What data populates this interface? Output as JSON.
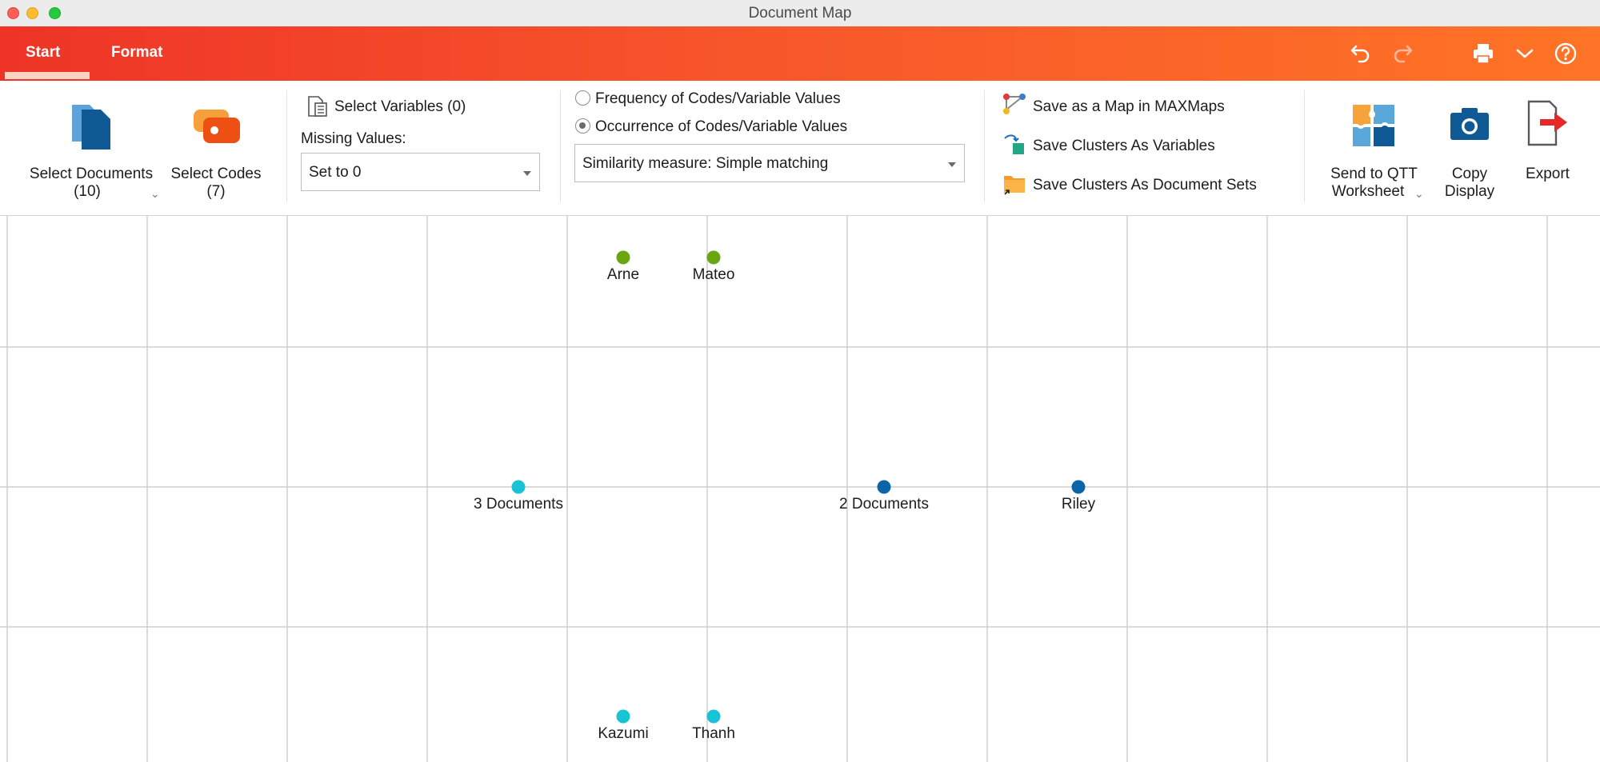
{
  "window": {
    "title": "Document Map"
  },
  "ribbon": {
    "tabs": [
      {
        "label": "Start",
        "active": true
      },
      {
        "label": "Format",
        "active": false
      }
    ],
    "right_icons": [
      "undo-icon",
      "redo-icon",
      "print-icon",
      "chevron-down-icon",
      "help-icon"
    ]
  },
  "toolbar": {
    "select_documents": {
      "line1": "Select Documents",
      "line2": "(10)"
    },
    "select_codes": {
      "line1": "Select Codes",
      "line2": "(7)"
    },
    "select_variables": "Select Variables (0)",
    "missing_values_label": "Missing Values:",
    "missing_values_value": "Set to 0",
    "radio_frequency": "Frequency of Codes/Variable Values",
    "radio_occurrence": "Occurrence of Codes/Variable Values",
    "selected_radio": "occurrence",
    "similarity_measure": "Similarity measure: Simple matching",
    "save_map": "Save as a Map in MAXMaps",
    "save_clusters_variables": "Save Clusters As Variables",
    "save_clusters_sets": "Save Clusters As Document Sets",
    "send_qtt": {
      "line1": "Send to QTT",
      "line2": "Worksheet"
    },
    "copy_display": {
      "line1": "Copy",
      "line2": "Display"
    },
    "export": "Export"
  },
  "map": {
    "points": [
      {
        "label": "Arne",
        "color": "#6aa612"
      },
      {
        "label": "Mateo",
        "color": "#6aa612"
      },
      {
        "label": "3 Documents",
        "color": "#18c3d6"
      },
      {
        "label": "2 Documents",
        "color": "#0b63a8"
      },
      {
        "label": "Riley",
        "color": "#0b63a8"
      },
      {
        "label": "Kazumi",
        "color": "#18c3d6"
      },
      {
        "label": "Thanh",
        "color": "#18c3d6"
      }
    ]
  },
  "colors": {
    "accent": "#f7552b",
    "grid": "#cfcfcf"
  }
}
